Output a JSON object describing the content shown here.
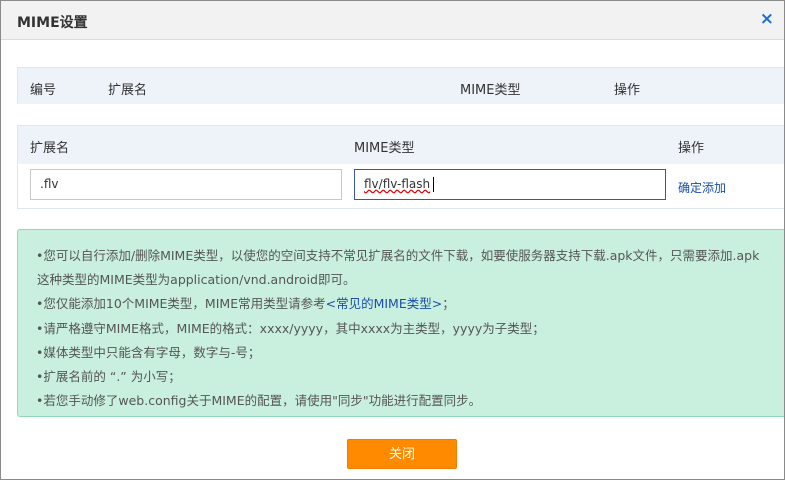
{
  "dialog": {
    "title": "MIME设置",
    "close_icon": "×"
  },
  "list_table": {
    "headers": [
      "编号",
      "扩展名",
      "MIME类型",
      "操作"
    ]
  },
  "add_form": {
    "headers": [
      "扩展名",
      "MIME类型",
      "操作"
    ],
    "extension_value": ".flv",
    "mime_value": "flv/flv-flash",
    "confirm_label": "确定添加"
  },
  "tips": [
    {
      "text": "•您可以自行添加/删除MIME类型，以使您的空间支持不常见扩展名的文件下载，如要使服务器支持下载.apk文件，只需要添加.apk"
    },
    {
      "text": "这种类型的MIME类型为application/vnd.android即可。"
    },
    {
      "text": "•您仅能添加10个MIME类型，MIME常用类型请参考",
      "link": "<常见的MIME类型>",
      "tail": "；"
    },
    {
      "text": "•请严格遵守MIME格式，MIME的格式：xxxx/yyyy，其中xxxx为主类型，yyyy为子类型；"
    },
    {
      "text": "•媒体类型中只能含有字母，数字与-号；"
    },
    {
      "text": "•扩展名前的 “.”  为小写；"
    },
    {
      "text": "•若您手动修了web.config关于MIME的配置，请使用\"同步\"功能进行配置同步。"
    }
  ],
  "footer": {
    "close_button": "关闭"
  },
  "colors": {
    "accent_orange": "#ff8a00",
    "tips_bg": "#c9f0df",
    "link_blue": "#1a4ea8"
  }
}
